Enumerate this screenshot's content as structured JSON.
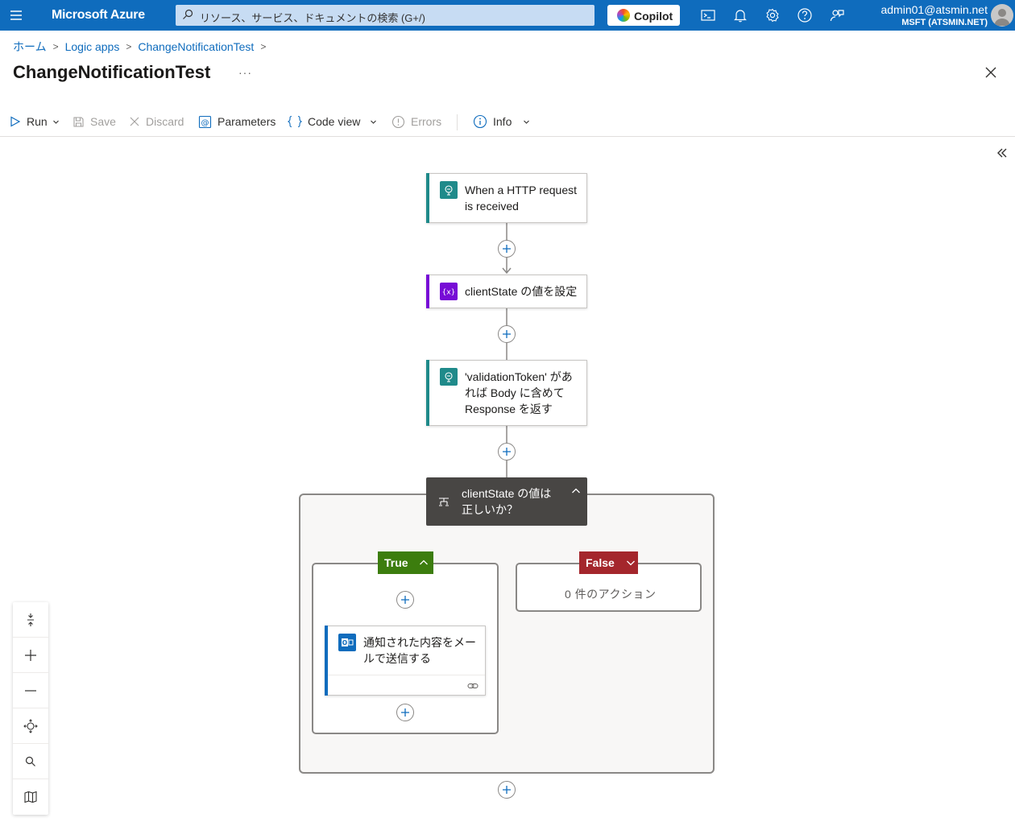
{
  "topbar": {
    "brand": "Microsoft Azure",
    "search_placeholder": "リソース、サービス、ドキュメントの検索 (G+/)",
    "copilot_label": "Copilot",
    "account_name": "admin01@atsmin.net",
    "account_directory": "MSFT (ATSMIN.NET)"
  },
  "breadcrumb": [
    "ホーム",
    "Logic apps",
    "ChangeNotificationTest"
  ],
  "page_title": "ChangeNotificationTest",
  "more_label": "···",
  "toolbar": {
    "run": "Run",
    "save": "Save",
    "discard": "Discard",
    "parameters": "Parameters",
    "code_view": "Code view",
    "errors": "Errors",
    "info": "Info"
  },
  "workflow": {
    "trigger": "When a HTTP request is received",
    "trigger_line1": "When a HTTP request",
    "trigger_line2": "is received",
    "set_variable": "clientState の値を設定",
    "response_line1": "'validationToken' があ",
    "response_line2": "れば Body に含めて",
    "response_line3": "Response を返す",
    "condition_line1": "clientState の値は",
    "condition_line2": "正しいか？",
    "true_label": "True",
    "false_label": "False",
    "email_line1": "通知された内容をメー",
    "email_line2": "ルで送信する",
    "false_empty": "0 件のアクション"
  },
  "colors": {
    "azure_blue": "#0f6cbd",
    "http_teal": "#1f8a8a",
    "variable_purple": "#770bd6",
    "true_green": "#3c7d0e",
    "false_red": "#a4262c",
    "outlook_blue": "#0f6cbd",
    "condition_dark": "#484644"
  },
  "icons": [
    "hamburger-icon",
    "search-icon",
    "cloud-shell-icon",
    "bell-icon",
    "gear-icon",
    "help-icon",
    "feedback-icon",
    "close-icon",
    "play-icon",
    "save-icon",
    "discard-icon",
    "parameters-icon",
    "code-icon",
    "errors-icon",
    "info-icon",
    "collapse-icon",
    "fit-icon",
    "zoom-in-icon",
    "zoom-out-icon",
    "center-icon",
    "search-canvas-icon",
    "minimap-icon"
  ]
}
